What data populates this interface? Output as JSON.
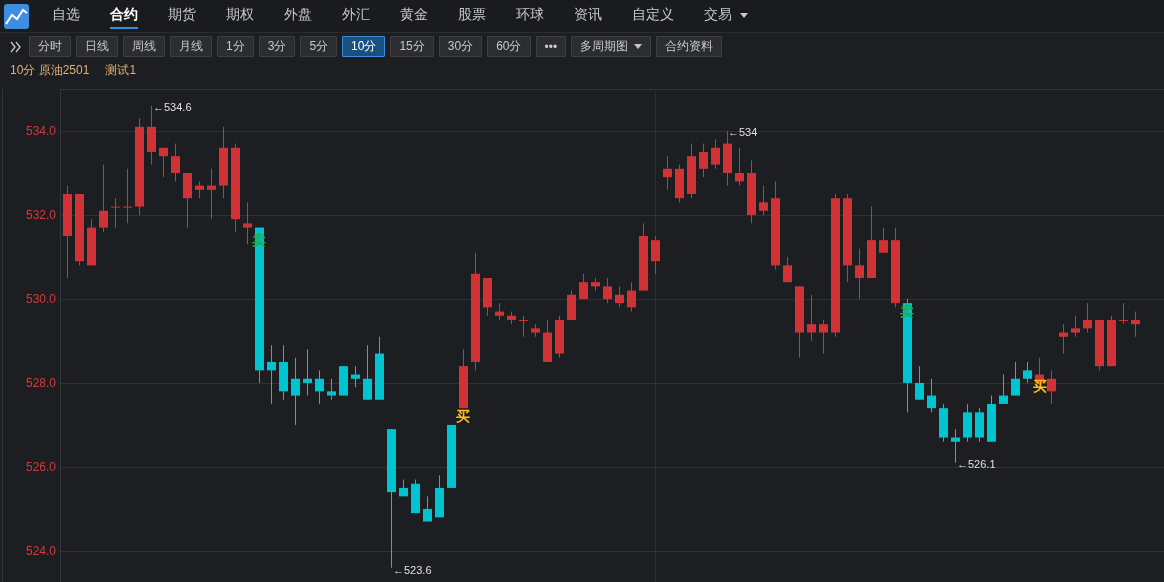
{
  "nav": {
    "tabs": [
      {
        "label": "自选",
        "selected": false
      },
      {
        "label": "合约",
        "selected": true
      },
      {
        "label": "期货",
        "selected": false
      },
      {
        "label": "期权",
        "selected": false
      },
      {
        "label": "外盘",
        "selected": false
      },
      {
        "label": "外汇",
        "selected": false
      },
      {
        "label": "黄金",
        "selected": false
      },
      {
        "label": "股票",
        "selected": false
      },
      {
        "label": "环球",
        "selected": false
      },
      {
        "label": "资讯",
        "selected": false
      },
      {
        "label": "自定义",
        "selected": false
      },
      {
        "label": "交易",
        "selected": false,
        "kind": "dropdown"
      }
    ]
  },
  "toolbar": {
    "buttons": [
      {
        "label": "分时",
        "selected": false,
        "kind": "button"
      },
      {
        "label": "日线",
        "selected": false,
        "kind": "button"
      },
      {
        "label": "周线",
        "selected": false,
        "kind": "button"
      },
      {
        "label": "月线",
        "selected": false,
        "kind": "button"
      },
      {
        "label": "1分",
        "selected": false,
        "kind": "button"
      },
      {
        "label": "3分",
        "selected": false,
        "kind": "button"
      },
      {
        "label": "5分",
        "selected": false,
        "kind": "button"
      },
      {
        "label": "10分",
        "selected": true,
        "kind": "button"
      },
      {
        "label": "15分",
        "selected": false,
        "kind": "button"
      },
      {
        "label": "30分",
        "selected": false,
        "kind": "button"
      },
      {
        "label": "60分",
        "selected": false,
        "kind": "button"
      },
      {
        "label": "•••",
        "selected": false,
        "kind": "button"
      },
      {
        "label": "多周期图",
        "selected": false,
        "kind": "dropdown"
      },
      {
        "label": "合约资料",
        "selected": false,
        "kind": "button"
      }
    ]
  },
  "info": {
    "period_symbol": "10分 原油2501",
    "indicator": "测试1"
  },
  "chart": {
    "chart_data": {
      "type": "candlestick",
      "grid": true,
      "ohlc": [
        [
          531.5,
          532.7,
          530.5,
          532.5
        ],
        [
          530.9,
          532.5,
          530.8,
          532.5
        ],
        [
          530.8,
          531.9,
          530.8,
          531.7
        ],
        [
          531.7,
          533.2,
          531.6,
          532.1
        ],
        [
          532.2,
          532.4,
          531.7,
          532.2
        ],
        [
          532.2,
          533.1,
          531.8,
          532.2
        ],
        [
          532.2,
          534.3,
          532.0,
          534.1
        ],
        [
          533.5,
          534.6,
          533.2,
          534.1
        ],
        [
          533.4,
          533.6,
          532.9,
          533.6
        ],
        [
          533.0,
          533.7,
          532.8,
          533.4
        ],
        [
          532.4,
          533.0,
          531.7,
          533.0
        ],
        [
          532.6,
          532.8,
          532.4,
          532.7
        ],
        [
          532.6,
          533.1,
          531.9,
          532.7
        ],
        [
          532.7,
          534.1,
          532.4,
          533.6
        ],
        [
          531.9,
          533.7,
          531.6,
          533.6
        ],
        [
          531.7,
          532.3,
          531.3,
          531.8
        ],
        [
          531.7,
          531.7,
          528.0,
          528.3
        ],
        [
          528.5,
          528.9,
          527.5,
          528.3
        ],
        [
          528.5,
          528.9,
          527.6,
          527.8
        ],
        [
          528.1,
          528.6,
          527.0,
          527.7
        ],
        [
          528.1,
          528.8,
          527.7,
          528.0
        ],
        [
          528.1,
          528.3,
          527.5,
          527.8
        ],
        [
          527.8,
          528.1,
          527.6,
          527.7
        ],
        [
          528.4,
          528.4,
          527.7,
          527.7
        ],
        [
          528.2,
          528.4,
          527.9,
          528.1
        ],
        [
          528.1,
          528.9,
          527.6,
          527.6
        ],
        [
          528.7,
          529.1,
          527.6,
          527.6
        ],
        [
          526.9,
          526.9,
          523.6,
          525.4
        ],
        [
          525.5,
          525.7,
          525.3,
          525.3
        ],
        [
          525.6,
          525.7,
          524.9,
          524.9
        ],
        [
          525.0,
          525.3,
          524.7,
          524.7
        ],
        [
          525.5,
          525.8,
          524.8,
          524.8
        ],
        [
          527.0,
          527.0,
          525.5,
          525.5
        ],
        [
          527.4,
          528.8,
          527.4,
          528.4
        ],
        [
          528.5,
          531.1,
          528.3,
          530.6
        ],
        [
          529.8,
          530.5,
          529.6,
          530.5
        ],
        [
          529.6,
          529.9,
          529.5,
          529.7
        ],
        [
          529.5,
          529.7,
          529.4,
          529.6
        ],
        [
          529.5,
          529.6,
          529.1,
          529.5
        ],
        [
          529.2,
          529.4,
          529.1,
          529.3
        ],
        [
          528.5,
          529.5,
          528.5,
          529.2
        ],
        [
          528.7,
          529.6,
          528.6,
          529.5
        ],
        [
          529.5,
          530.2,
          529.5,
          530.1
        ],
        [
          530.0,
          530.6,
          530.0,
          530.4
        ],
        [
          530.3,
          530.5,
          530.2,
          530.4
        ],
        [
          530.0,
          530.5,
          529.9,
          530.3
        ],
        [
          529.9,
          530.3,
          529.8,
          530.1
        ],
        [
          529.8,
          530.4,
          529.7,
          530.2
        ],
        [
          530.2,
          531.8,
          530.2,
          531.5
        ],
        [
          530.9,
          531.5,
          530.6,
          531.4
        ],
        [
          532.9,
          533.4,
          532.6,
          533.1
        ],
        [
          532.4,
          533.2,
          532.3,
          533.1
        ],
        [
          532.5,
          533.7,
          532.4,
          533.4
        ],
        [
          533.1,
          533.7,
          532.9,
          533.5
        ],
        [
          533.2,
          533.8,
          533.1,
          533.6
        ],
        [
          533.0,
          534.0,
          532.7,
          533.7
        ],
        [
          532.8,
          533.6,
          532.7,
          533.0
        ],
        [
          532.0,
          533.3,
          531.8,
          533.0
        ],
        [
          532.1,
          532.7,
          532.0,
          532.3
        ],
        [
          530.8,
          532.8,
          530.7,
          532.4
        ],
        [
          530.4,
          531.0,
          530.4,
          530.8
        ],
        [
          529.2,
          530.3,
          528.6,
          530.3
        ],
        [
          529.2,
          530.1,
          529.0,
          529.4
        ],
        [
          529.2,
          529.5,
          528.7,
          529.4
        ],
        [
          529.2,
          532.5,
          529.1,
          532.4
        ],
        [
          530.8,
          532.5,
          530.4,
          532.4
        ],
        [
          530.5,
          531.2,
          530.0,
          530.8
        ],
        [
          530.5,
          532.2,
          530.5,
          531.4
        ],
        [
          531.1,
          531.7,
          531.1,
          531.4
        ],
        [
          529.9,
          531.7,
          529.8,
          531.4
        ],
        [
          529.9,
          530.0,
          527.3,
          528.0
        ],
        [
          528.0,
          528.4,
          527.6,
          527.6
        ],
        [
          527.7,
          528.1,
          527.3,
          527.4
        ],
        [
          527.4,
          527.5,
          526.6,
          526.7
        ],
        [
          526.7,
          526.9,
          526.1,
          526.6
        ],
        [
          527.3,
          527.5,
          526.6,
          526.7
        ],
        [
          527.3,
          527.4,
          526.6,
          526.7
        ],
        [
          527.5,
          527.7,
          526.6,
          526.6
        ],
        [
          527.7,
          528.2,
          527.5,
          527.5
        ],
        [
          528.1,
          528.5,
          527.7,
          527.7
        ],
        [
          528.3,
          528.5,
          528.0,
          528.1
        ],
        [
          528.0,
          528.6,
          527.8,
          528.2
        ],
        [
          527.8,
          528.3,
          527.5,
          528.1
        ],
        [
          529.1,
          529.4,
          528.7,
          529.2
        ],
        [
          529.2,
          529.6,
          529.1,
          529.3
        ],
        [
          529.3,
          529.9,
          529.2,
          529.5
        ],
        [
          528.4,
          529.5,
          528.3,
          529.5
        ],
        [
          528.4,
          529.6,
          528.4,
          529.5
        ],
        [
          529.5,
          529.9,
          529.4,
          529.5
        ],
        [
          529.4,
          529.7,
          529.1,
          529.5
        ]
      ],
      "ylim": [
        523.26,
        535
      ],
      "yticks": [
        {
          "value": 534,
          "label": "534.0"
        },
        {
          "value": 532,
          "label": "532.0"
        },
        {
          "value": 530,
          "label": "530.0"
        },
        {
          "value": 528,
          "label": "528.0"
        },
        {
          "value": 526,
          "label": "526.0"
        },
        {
          "value": 524,
          "label": "524.0"
        }
      ]
    },
    "price_labels": [
      "←534.6",
      "←534",
      "←523.6",
      "←526.1"
    ],
    "signals": [
      {
        "text": "卖",
        "kind": "sell"
      },
      {
        "text": "买",
        "kind": "buy"
      },
      {
        "text": "卖",
        "kind": "sell"
      },
      {
        "text": "买",
        "kind": "buy"
      }
    ]
  }
}
